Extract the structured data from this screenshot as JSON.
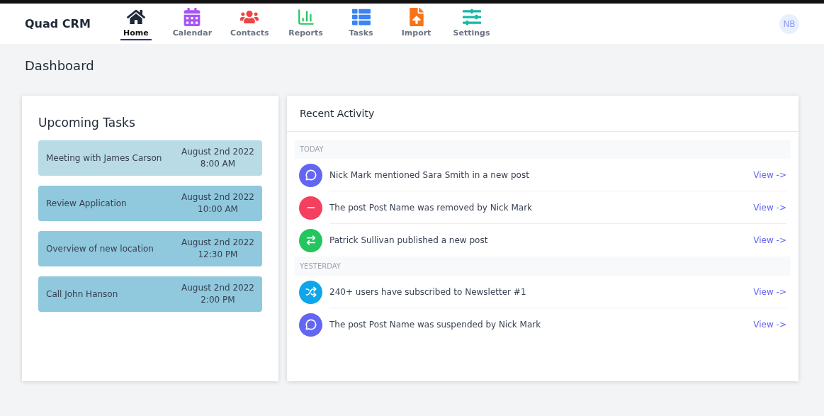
{
  "app": {
    "title": "Quad CRM",
    "avatar": "NB"
  },
  "nav": [
    {
      "label": "Home",
      "selected": true
    },
    {
      "label": "Calendar",
      "selected": false
    },
    {
      "label": "Contacts",
      "selected": false
    },
    {
      "label": "Reports",
      "selected": false
    },
    {
      "label": "Tasks",
      "selected": false
    },
    {
      "label": "Import",
      "selected": false
    },
    {
      "label": "Settings",
      "selected": false
    }
  ],
  "page_title": "Dashboard",
  "tasks": {
    "title": "Upcoming Tasks",
    "items": [
      {
        "name": "Meeting with James Carson",
        "date": "August 2nd 2022",
        "time": "8:00 AM",
        "selected": true
      },
      {
        "name": "Review Application",
        "date": "August 2nd 2022",
        "time": "10:00 AM",
        "selected": false
      },
      {
        "name": "Overview of new location",
        "date": "August 2nd 2022",
        "time": "12:30 PM",
        "selected": false
      },
      {
        "name": "Call John Hanson",
        "date": "August 2nd 2022",
        "time": "2:00 PM",
        "selected": false
      }
    ]
  },
  "activity": {
    "title": "Recent Activity",
    "groups": [
      {
        "label": "TODAY",
        "items": [
          {
            "kind": "mention",
            "color": "#6366f1",
            "text": "Nick Mark mentioned Sara Smith in a new post",
            "link": "View ->"
          },
          {
            "kind": "remove",
            "color": "#f43f5e",
            "text": "The post Post Name was removed by Nick Mark",
            "link": "View ->"
          },
          {
            "kind": "publish",
            "color": "#22c55e",
            "text": "Patrick Sullivan published a new post",
            "link": "View ->"
          }
        ]
      },
      {
        "label": "YESTERDAY",
        "items": [
          {
            "kind": "subscribe",
            "color": "#0ea5e9",
            "text": "240+ users have subscribed to Newsletter #1",
            "link": "View ->"
          },
          {
            "kind": "mention",
            "color": "#6366f1",
            "text": "The post Post Name was suspended by Nick Mark",
            "link": "View ->"
          }
        ]
      }
    ]
  }
}
